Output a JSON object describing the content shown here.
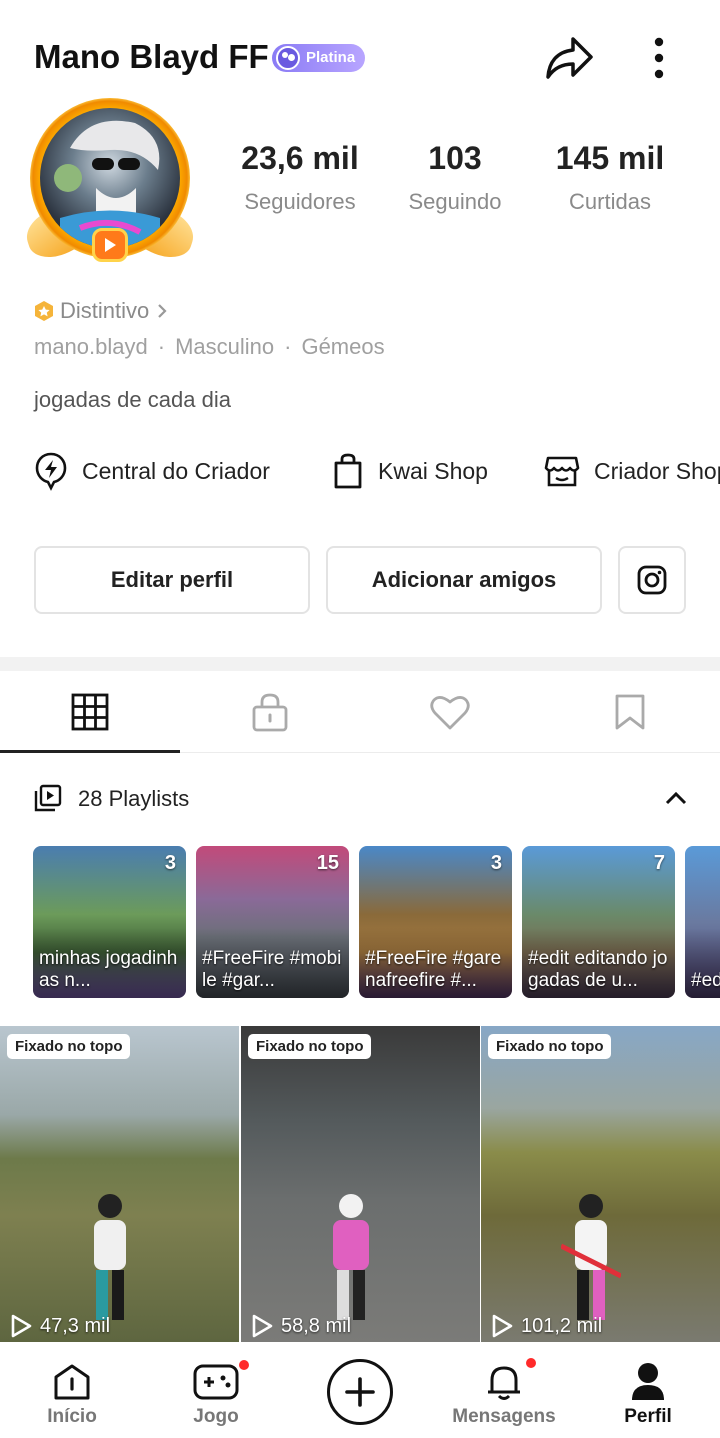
{
  "header": {
    "name": "Mano Blayd FF",
    "badge": "Platina"
  },
  "stats": [
    {
      "value": "23,6 mil",
      "label": "Seguidores"
    },
    {
      "value": "103",
      "label": "Seguindo"
    },
    {
      "value": "145 mil",
      "label": "Curtidas"
    }
  ],
  "profile": {
    "distintivo": "Distintivo",
    "username": "mano.blayd",
    "gender": "Masculino",
    "sign": "Gémeos",
    "bio": "jogadas de cada dia"
  },
  "shortcuts": [
    {
      "label": "Central do Criador",
      "icon": "lightning-icon"
    },
    {
      "label": "Kwai Shop",
      "icon": "shopping-bag-icon"
    },
    {
      "label": "Criador Shop",
      "icon": "store-icon"
    }
  ],
  "buttons": {
    "edit": "Editar perfil",
    "add_friends": "Adicionar amigos",
    "instagram_icon": "instagram-icon"
  },
  "tabs": [
    {
      "name": "grid",
      "icon": "grid-icon",
      "active": true
    },
    {
      "name": "private",
      "icon": "lock-icon",
      "active": false
    },
    {
      "name": "liked",
      "icon": "heart-icon",
      "active": false
    },
    {
      "name": "saved",
      "icon": "bookmark-icon",
      "active": false
    }
  ],
  "playlists": {
    "title": "28 Playlists",
    "items": [
      {
        "count": "3",
        "caption": "minhas jogadinhas n..."
      },
      {
        "count": "15",
        "caption": "#FreeFire #mobile #gar..."
      },
      {
        "count": "3",
        "caption": "#FreeFire #garenafreefire #..."
      },
      {
        "count": "7",
        "caption": "#edit editando jogadas de u..."
      },
      {
        "count": "",
        "caption": "#ed #Fr"
      }
    ]
  },
  "videos": [
    {
      "pin": "Fixado no topo",
      "views": "47,3 mil"
    },
    {
      "pin": "Fixado no topo",
      "views": "58,8 mil"
    },
    {
      "pin": "Fixado no topo",
      "views": "101,2 mil"
    }
  ],
  "nav": [
    {
      "label": "Início",
      "icon": "home-icon",
      "active": false,
      "dot": false
    },
    {
      "label": "Jogo",
      "icon": "gamepad-icon",
      "active": false,
      "dot": true
    },
    {
      "label": "",
      "icon": "plus-icon",
      "active": false,
      "dot": false
    },
    {
      "label": "Mensagens",
      "icon": "bell-icon",
      "active": false,
      "dot": true
    },
    {
      "label": "Perfil",
      "icon": "profile-icon",
      "active": true,
      "dot": false
    }
  ],
  "colors": {
    "badge": "#8a7bf5",
    "avatar_ring": "#f5a000",
    "notification_dot": "#ff2a2a",
    "text_secondary": "#8a8a8a"
  }
}
